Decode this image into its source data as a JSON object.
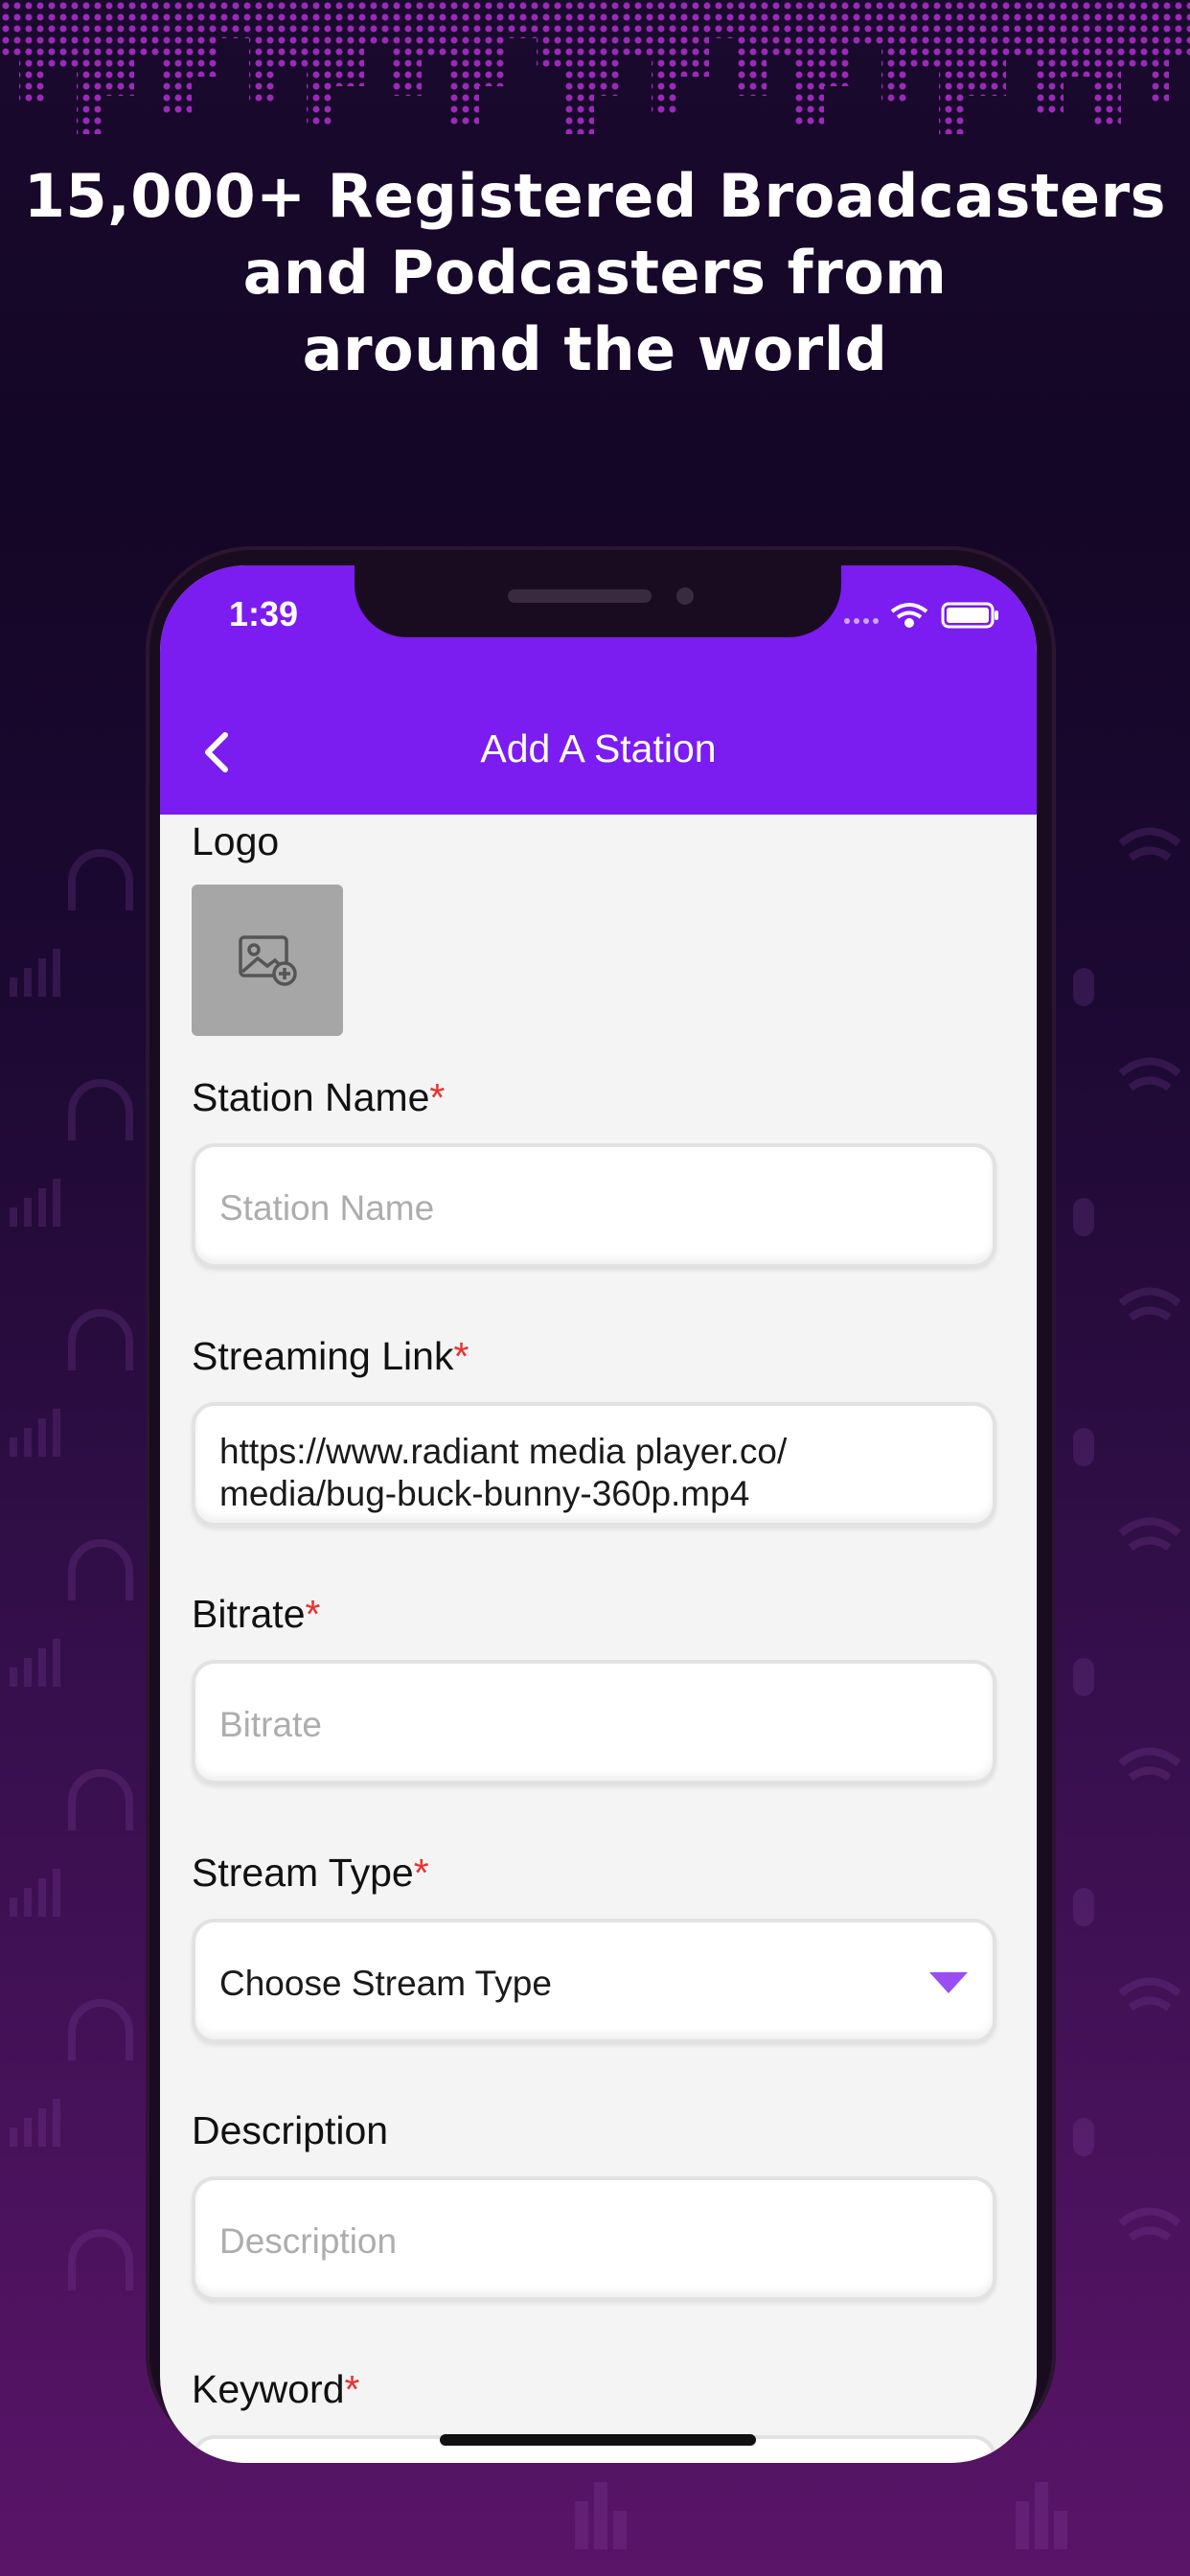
{
  "headline": {
    "line1": "15,000+ Registered Broadcasters",
    "line2": "and Podcasters from",
    "line3": "around the world"
  },
  "status_bar": {
    "time": "1:39",
    "icons": [
      "signal-icon",
      "wifi-icon",
      "battery-icon"
    ]
  },
  "nav": {
    "title": "Add A Station",
    "back_icon": "chevron-left-icon"
  },
  "form": {
    "logo_label": "Logo",
    "logo_icon": "image-add-icon",
    "station_name": {
      "label": "Station Name",
      "required_mark": "*",
      "placeholder": "Station Name"
    },
    "streaming_link": {
      "label": "Streaming Link",
      "required_mark": "*",
      "value_line1": "https://www.radiant media player.co/",
      "value_line2": "media/bug-buck-bunny-360p.mp4"
    },
    "bitrate": {
      "label": "Bitrate",
      "required_mark": "*",
      "placeholder": "Bitrate"
    },
    "stream_type": {
      "label": "Stream Type",
      "required_mark": "*",
      "selected": "Choose Stream Type"
    },
    "description": {
      "label": "Description",
      "placeholder": "Description"
    },
    "keyword": {
      "label": "Keyword",
      "required_mark": "*"
    }
  },
  "colors": {
    "accent": "#7b1cf0",
    "required": "#e8322e",
    "dropdown_arrow": "#9a4df2"
  }
}
